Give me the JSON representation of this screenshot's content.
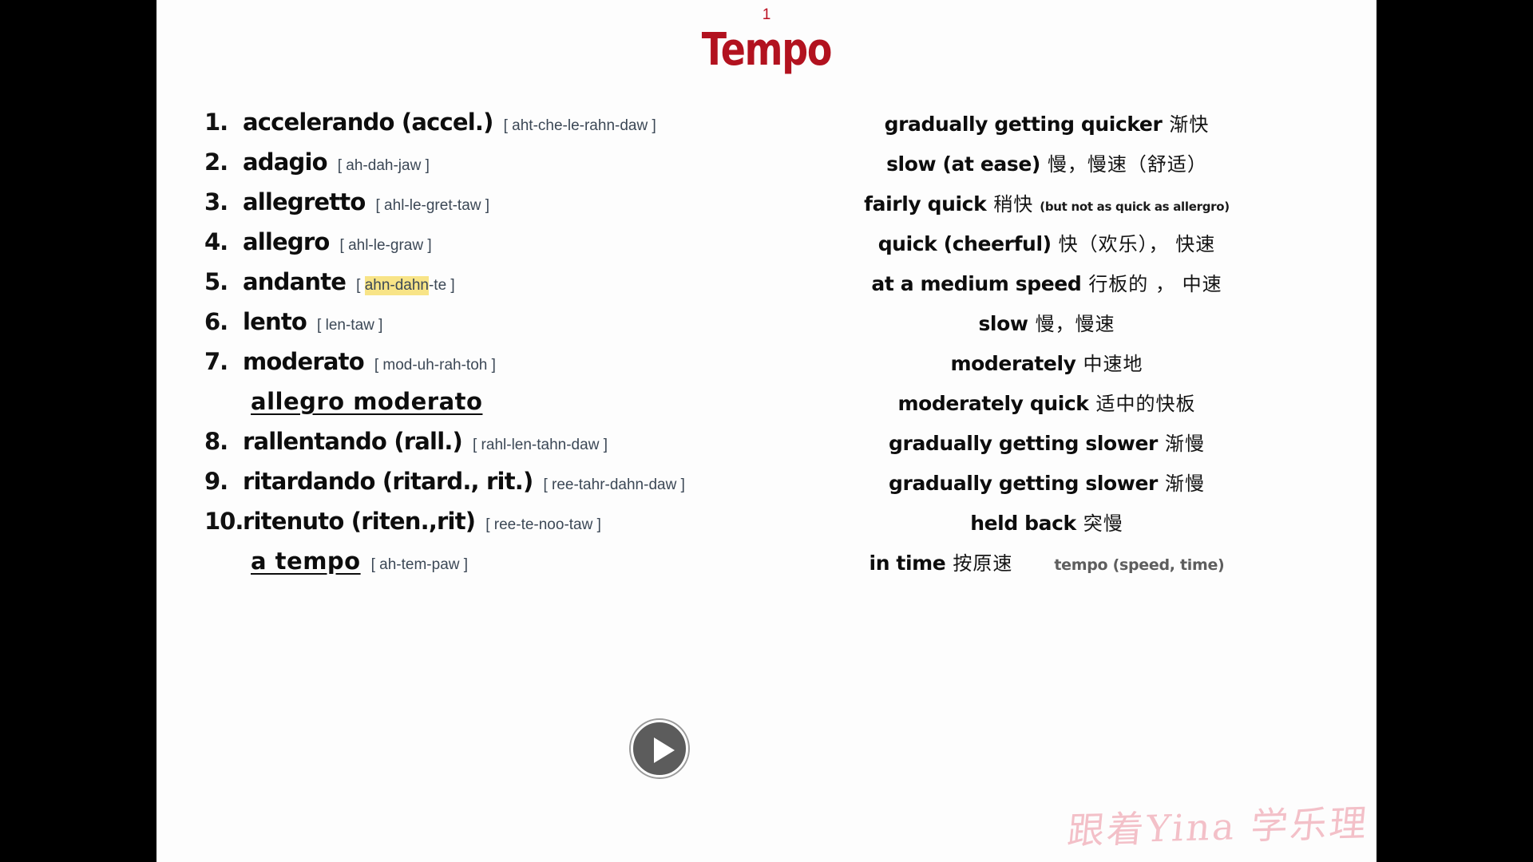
{
  "slide": {
    "number": "1",
    "title": "Tempo",
    "accent_color": "#b2121f",
    "highlight_color": "#f8e487",
    "pronunciation_color": "#3c4856",
    "background_color": "#fdfdfd",
    "letterbox_color": "#000000"
  },
  "terms": [
    {
      "number": "1.",
      "term": "accelerando (accel.)",
      "pron_open": "[ aht-che-le-rahn-daw ]",
      "pron_pre": "[ aht-che-le-rahn-daw ]",
      "pron_hl": "",
      "pron_post": "",
      "highlighted": false
    },
    {
      "number": "2.",
      "term": "adagio",
      "pron_pre": "[ ah-dah-jaw ]",
      "pron_hl": "",
      "pron_post": "",
      "highlighted": false
    },
    {
      "number": "3.",
      "term": "allegretto",
      "pron_pre": "[ ahl-le-gret-taw ]",
      "pron_hl": "",
      "pron_post": "",
      "highlighted": false
    },
    {
      "number": "4.",
      "term": "allegro",
      "pron_pre": "[ ahl-le-graw ]",
      "pron_hl": "",
      "pron_post": "",
      "highlighted": false
    },
    {
      "number": "5.",
      "term": "andante",
      "pron_pre": "[ ",
      "pron_hl": "ahn-dahn",
      "pron_post": "-te ]",
      "highlighted": true
    },
    {
      "number": "6.",
      "term": "lento",
      "pron_pre": "[ len-taw ]",
      "pron_hl": "",
      "pron_post": "",
      "highlighted": false
    },
    {
      "number": "7.",
      "term": "moderato",
      "pron_pre": "[ mod-uh-rah-toh ]",
      "pron_hl": "",
      "pron_post": "",
      "highlighted": false
    },
    {
      "number": "",
      "term": "allegro moderato",
      "pron_pre": "",
      "pron_hl": "",
      "pron_post": "",
      "sub": true,
      "highlighted": false
    },
    {
      "number": "8.",
      "term": "rallentando (rall.)",
      "pron_pre": "[ rahl-len-tahn-daw ]",
      "pron_hl": "",
      "pron_post": "",
      "highlighted": false
    },
    {
      "number": "9.",
      "term": "ritardando (ritard., rit.)",
      "pron_pre": "[ ree-tahr-dahn-daw ]",
      "pron_hl": "",
      "pron_post": "",
      "highlighted": false
    },
    {
      "number": "10.",
      "term": "ritenuto (riten.,rit)",
      "pron_pre": "[ ree-te-noo-taw ]",
      "pron_hl": "",
      "pron_post": "",
      "highlighted": false
    },
    {
      "number": "",
      "term": "a tempo",
      "pron_pre": "[ ah-tem-paw ]",
      "pron_hl": "",
      "pron_post": "",
      "sub": true,
      "highlighted": false
    }
  ],
  "meanings": [
    {
      "en": "gradually getting quicker",
      "cn": "渐快",
      "note": ""
    },
    {
      "en": "slow (at ease)",
      "cn": "慢，慢速（舒适）",
      "note": ""
    },
    {
      "en": "fairly quick",
      "cn": "稍快",
      "note": "(but not as quick as allergro)"
    },
    {
      "en": "quick (cheerful)",
      "cn": "快（欢乐）， 快速",
      "note": ""
    },
    {
      "en": "at a medium speed",
      "cn": "行板的 ， 中速",
      "note": ""
    },
    {
      "en": "slow",
      "cn": "慢，慢速",
      "note": ""
    },
    {
      "en": "moderately",
      "cn": "中速地",
      "note": ""
    },
    {
      "en": "moderately quick",
      "cn": "适中的快板",
      "note": ""
    },
    {
      "en": "gradually getting slower",
      "cn": "渐慢",
      "note": ""
    },
    {
      "en": "gradually getting slower",
      "cn": "渐慢",
      "note": ""
    },
    {
      "en": "held back",
      "cn": "突慢",
      "note": ""
    },
    {
      "en": "in time",
      "cn": "按原速",
      "note": "tempo (speed, time)"
    }
  ],
  "player": {
    "play_label": "play"
  },
  "watermark": {
    "text": "跟着Yina 学乐理",
    "color": "#f0a9b4"
  }
}
